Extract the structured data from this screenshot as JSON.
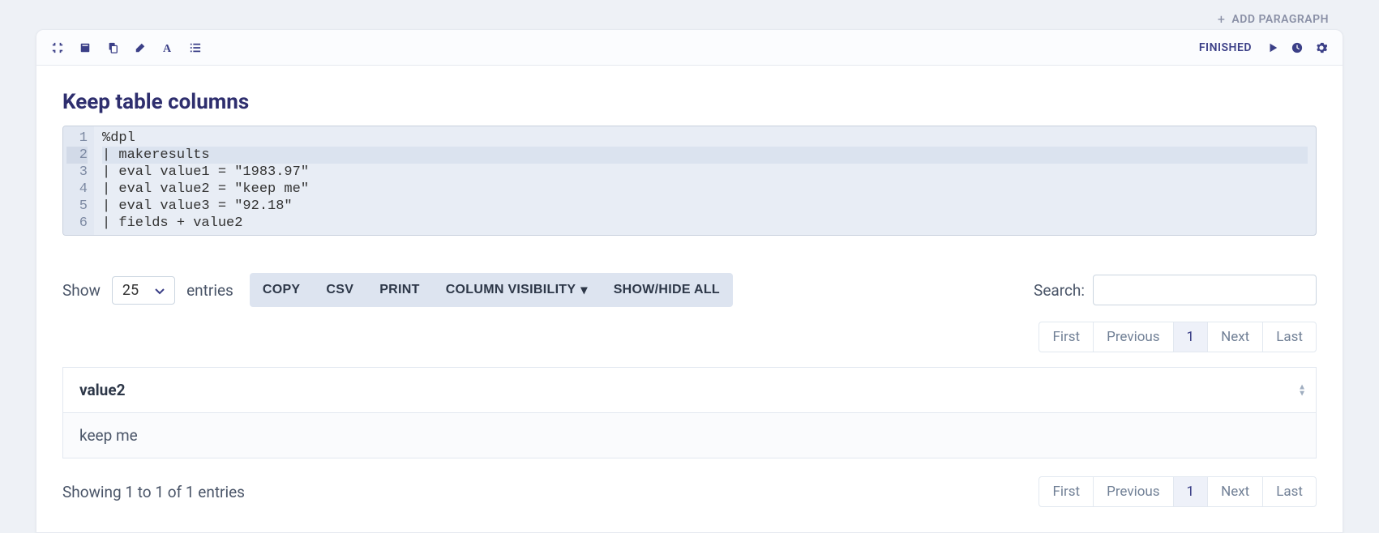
{
  "header": {
    "add_paragraph": "ADD PARAGRAPH",
    "status": "FINISHED"
  },
  "title": "Keep table columns",
  "code": {
    "lines": [
      "%dpl",
      "| makeresults",
      "| eval value1 = \"1983.97\"",
      "| eval value2 = \"keep me\"",
      "| eval value3 = \"92.18\"",
      "| fields + value2"
    ],
    "highlighted_line_index": 1
  },
  "table_controls": {
    "show_label": "Show",
    "entries_label": "entries",
    "page_size": "25",
    "buttons": {
      "copy": "COPY",
      "csv": "CSV",
      "print": "PRINT",
      "column_visibility": "COLUMN VISIBILITY",
      "show_hide_all": "SHOW/HIDE ALL"
    },
    "search_label": "Search:"
  },
  "pagination": {
    "first": "First",
    "previous": "Previous",
    "page": "1",
    "next": "Next",
    "last": "Last"
  },
  "table": {
    "columns": [
      "value2"
    ],
    "rows": [
      {
        "value2": "keep me"
      }
    ]
  },
  "footer": {
    "showing": "Showing 1 to 1 of 1 entries"
  }
}
